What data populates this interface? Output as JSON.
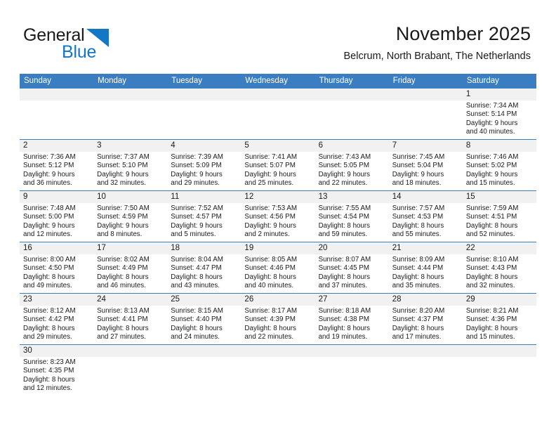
{
  "brand": {
    "name_top": "General",
    "name_bottom": "Blue",
    "color_blue": "#1277c4"
  },
  "header": {
    "title": "November 2025",
    "subtitle": "Belcrum, North Brabant, The Netherlands"
  },
  "theme": {
    "header_blue": "#3b7dc1",
    "row_shade": "#f1f1f1",
    "text": "#1a1a1a"
  },
  "weekdays": [
    "Sunday",
    "Monday",
    "Tuesday",
    "Wednesday",
    "Thursday",
    "Friday",
    "Saturday"
  ],
  "weeks": [
    [
      {
        "day": "",
        "lines": []
      },
      {
        "day": "",
        "lines": []
      },
      {
        "day": "",
        "lines": []
      },
      {
        "day": "",
        "lines": []
      },
      {
        "day": "",
        "lines": []
      },
      {
        "day": "",
        "lines": []
      },
      {
        "day": "1",
        "lines": [
          "Sunrise: 7:34 AM",
          "Sunset: 5:14 PM",
          "Daylight: 9 hours",
          "and 40 minutes."
        ]
      }
    ],
    [
      {
        "day": "2",
        "lines": [
          "Sunrise: 7:36 AM",
          "Sunset: 5:12 PM",
          "Daylight: 9 hours",
          "and 36 minutes."
        ]
      },
      {
        "day": "3",
        "lines": [
          "Sunrise: 7:37 AM",
          "Sunset: 5:10 PM",
          "Daylight: 9 hours",
          "and 32 minutes."
        ]
      },
      {
        "day": "4",
        "lines": [
          "Sunrise: 7:39 AM",
          "Sunset: 5:09 PM",
          "Daylight: 9 hours",
          "and 29 minutes."
        ]
      },
      {
        "day": "5",
        "lines": [
          "Sunrise: 7:41 AM",
          "Sunset: 5:07 PM",
          "Daylight: 9 hours",
          "and 25 minutes."
        ]
      },
      {
        "day": "6",
        "lines": [
          "Sunrise: 7:43 AM",
          "Sunset: 5:05 PM",
          "Daylight: 9 hours",
          "and 22 minutes."
        ]
      },
      {
        "day": "7",
        "lines": [
          "Sunrise: 7:45 AM",
          "Sunset: 5:04 PM",
          "Daylight: 9 hours",
          "and 18 minutes."
        ]
      },
      {
        "day": "8",
        "lines": [
          "Sunrise: 7:46 AM",
          "Sunset: 5:02 PM",
          "Daylight: 9 hours",
          "and 15 minutes."
        ]
      }
    ],
    [
      {
        "day": "9",
        "lines": [
          "Sunrise: 7:48 AM",
          "Sunset: 5:00 PM",
          "Daylight: 9 hours",
          "and 12 minutes."
        ]
      },
      {
        "day": "10",
        "lines": [
          "Sunrise: 7:50 AM",
          "Sunset: 4:59 PM",
          "Daylight: 9 hours",
          "and 8 minutes."
        ]
      },
      {
        "day": "11",
        "lines": [
          "Sunrise: 7:52 AM",
          "Sunset: 4:57 PM",
          "Daylight: 9 hours",
          "and 5 minutes."
        ]
      },
      {
        "day": "12",
        "lines": [
          "Sunrise: 7:53 AM",
          "Sunset: 4:56 PM",
          "Daylight: 9 hours",
          "and 2 minutes."
        ]
      },
      {
        "day": "13",
        "lines": [
          "Sunrise: 7:55 AM",
          "Sunset: 4:54 PM",
          "Daylight: 8 hours",
          "and 59 minutes."
        ]
      },
      {
        "day": "14",
        "lines": [
          "Sunrise: 7:57 AM",
          "Sunset: 4:53 PM",
          "Daylight: 8 hours",
          "and 55 minutes."
        ]
      },
      {
        "day": "15",
        "lines": [
          "Sunrise: 7:59 AM",
          "Sunset: 4:51 PM",
          "Daylight: 8 hours",
          "and 52 minutes."
        ]
      }
    ],
    [
      {
        "day": "16",
        "lines": [
          "Sunrise: 8:00 AM",
          "Sunset: 4:50 PM",
          "Daylight: 8 hours",
          "and 49 minutes."
        ]
      },
      {
        "day": "17",
        "lines": [
          "Sunrise: 8:02 AM",
          "Sunset: 4:49 PM",
          "Daylight: 8 hours",
          "and 46 minutes."
        ]
      },
      {
        "day": "18",
        "lines": [
          "Sunrise: 8:04 AM",
          "Sunset: 4:47 PM",
          "Daylight: 8 hours",
          "and 43 minutes."
        ]
      },
      {
        "day": "19",
        "lines": [
          "Sunrise: 8:05 AM",
          "Sunset: 4:46 PM",
          "Daylight: 8 hours",
          "and 40 minutes."
        ]
      },
      {
        "day": "20",
        "lines": [
          "Sunrise: 8:07 AM",
          "Sunset: 4:45 PM",
          "Daylight: 8 hours",
          "and 37 minutes."
        ]
      },
      {
        "day": "21",
        "lines": [
          "Sunrise: 8:09 AM",
          "Sunset: 4:44 PM",
          "Daylight: 8 hours",
          "and 35 minutes."
        ]
      },
      {
        "day": "22",
        "lines": [
          "Sunrise: 8:10 AM",
          "Sunset: 4:43 PM",
          "Daylight: 8 hours",
          "and 32 minutes."
        ]
      }
    ],
    [
      {
        "day": "23",
        "lines": [
          "Sunrise: 8:12 AM",
          "Sunset: 4:42 PM",
          "Daylight: 8 hours",
          "and 29 minutes."
        ]
      },
      {
        "day": "24",
        "lines": [
          "Sunrise: 8:13 AM",
          "Sunset: 4:41 PM",
          "Daylight: 8 hours",
          "and 27 minutes."
        ]
      },
      {
        "day": "25",
        "lines": [
          "Sunrise: 8:15 AM",
          "Sunset: 4:40 PM",
          "Daylight: 8 hours",
          "and 24 minutes."
        ]
      },
      {
        "day": "26",
        "lines": [
          "Sunrise: 8:17 AM",
          "Sunset: 4:39 PM",
          "Daylight: 8 hours",
          "and 22 minutes."
        ]
      },
      {
        "day": "27",
        "lines": [
          "Sunrise: 8:18 AM",
          "Sunset: 4:38 PM",
          "Daylight: 8 hours",
          "and 19 minutes."
        ]
      },
      {
        "day": "28",
        "lines": [
          "Sunrise: 8:20 AM",
          "Sunset: 4:37 PM",
          "Daylight: 8 hours",
          "and 17 minutes."
        ]
      },
      {
        "day": "29",
        "lines": [
          "Sunrise: 8:21 AM",
          "Sunset: 4:36 PM",
          "Daylight: 8 hours",
          "and 15 minutes."
        ]
      }
    ],
    [
      {
        "day": "30",
        "lines": [
          "Sunrise: 8:23 AM",
          "Sunset: 4:35 PM",
          "Daylight: 8 hours",
          "and 12 minutes."
        ]
      },
      {
        "day": "",
        "lines": []
      },
      {
        "day": "",
        "lines": []
      },
      {
        "day": "",
        "lines": []
      },
      {
        "day": "",
        "lines": []
      },
      {
        "day": "",
        "lines": []
      },
      {
        "day": "",
        "lines": []
      }
    ]
  ]
}
